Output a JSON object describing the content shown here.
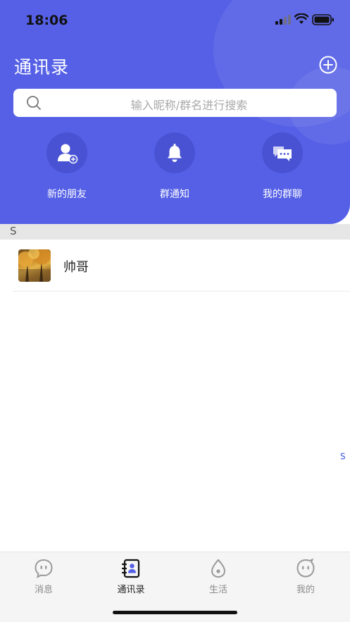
{
  "status_bar": {
    "time": "18:06"
  },
  "header": {
    "title": "通讯录",
    "add_icon": "plus-circle-icon"
  },
  "search": {
    "placeholder": "输入昵称/群名进行搜索",
    "icon": "search-icon"
  },
  "quick_actions": [
    {
      "label": "新的朋友",
      "icon": "add-friend-icon"
    },
    {
      "label": "群通知",
      "icon": "bell-icon"
    },
    {
      "label": "我的群聊",
      "icon": "group-chat-icon"
    }
  ],
  "sections": [
    {
      "letter": "S",
      "contacts": [
        {
          "name": "帅哥"
        }
      ]
    }
  ],
  "index_bar": [
    "S"
  ],
  "tabs": [
    {
      "label": "消息",
      "icon": "message-icon",
      "active": false
    },
    {
      "label": "通讯录",
      "icon": "contacts-icon",
      "active": true
    },
    {
      "label": "生活",
      "icon": "life-icon",
      "active": false
    },
    {
      "label": "我的",
      "icon": "profile-icon",
      "active": false
    }
  ],
  "colors": {
    "primary": "#5560e6",
    "circle": "#4852d3",
    "index": "#3d5bd9"
  }
}
